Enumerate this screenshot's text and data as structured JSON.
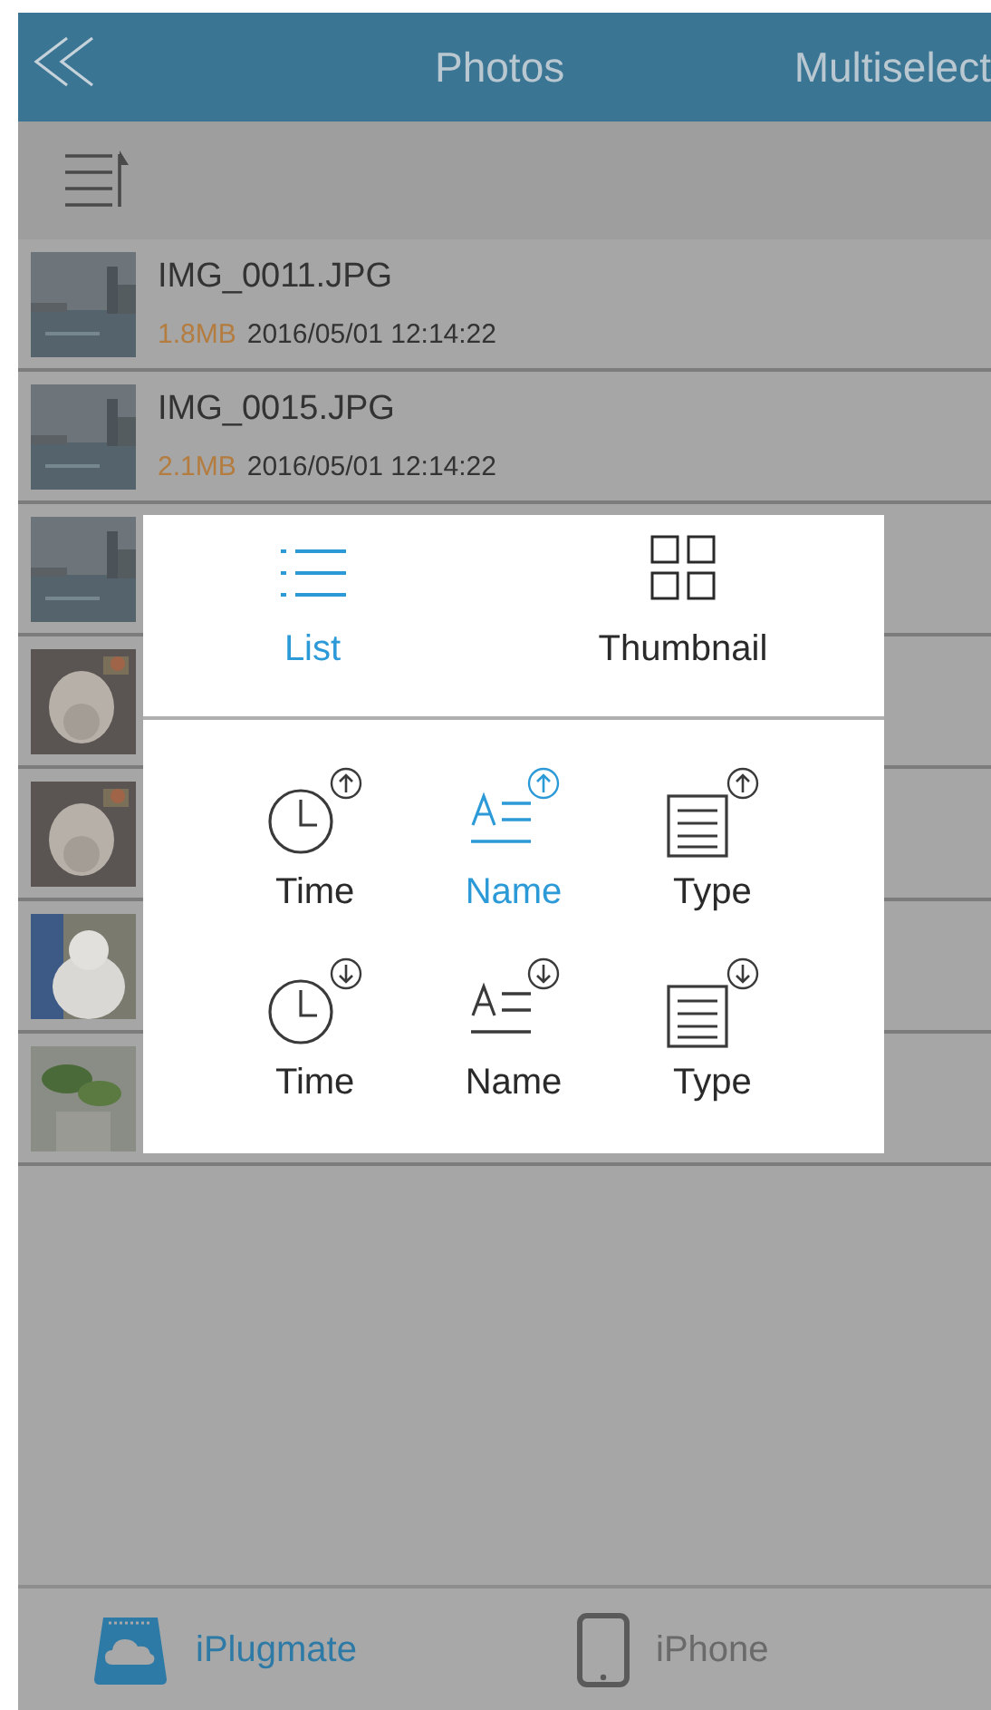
{
  "header": {
    "title": "Photos",
    "action": "Multiselect"
  },
  "files": [
    {
      "kind": "file",
      "name": "IMG_0011.JPG",
      "size": "1.8MB",
      "date": "2016/05/01 12:14:22"
    },
    {
      "kind": "file",
      "name": "IMG_0015.JPG",
      "size": "2.1MB",
      "date": "2016/05/01 12:14:22"
    },
    {
      "kind": "picture"
    },
    {
      "kind": "picture"
    },
    {
      "kind": "picture"
    },
    {
      "kind": "picture"
    },
    {
      "kind": "picture"
    }
  ],
  "popup": {
    "views": [
      {
        "kind": "list",
        "label": "List",
        "selected": true
      },
      {
        "kind": "grid",
        "label": "Thumbnail",
        "selected": false
      }
    ],
    "sorts": [
      {
        "kind": "time",
        "ascending": true,
        "label": "Time",
        "selected": false
      },
      {
        "kind": "name",
        "ascending": true,
        "label": "Name",
        "selected": true
      },
      {
        "kind": "type",
        "ascending": true,
        "label": "Type",
        "selected": false
      },
      {
        "kind": "time",
        "ascending": false,
        "label": "Time",
        "selected": false
      },
      {
        "kind": "name",
        "ascending": false,
        "label": "Name",
        "selected": false
      },
      {
        "kind": "type",
        "ascending": false,
        "label": "Type",
        "selected": false
      }
    ]
  },
  "tabs": [
    {
      "kind": "drive",
      "label": "iPlugmate",
      "selected": true
    },
    {
      "kind": "phone",
      "label": "iPhone",
      "selected": false
    }
  ]
}
